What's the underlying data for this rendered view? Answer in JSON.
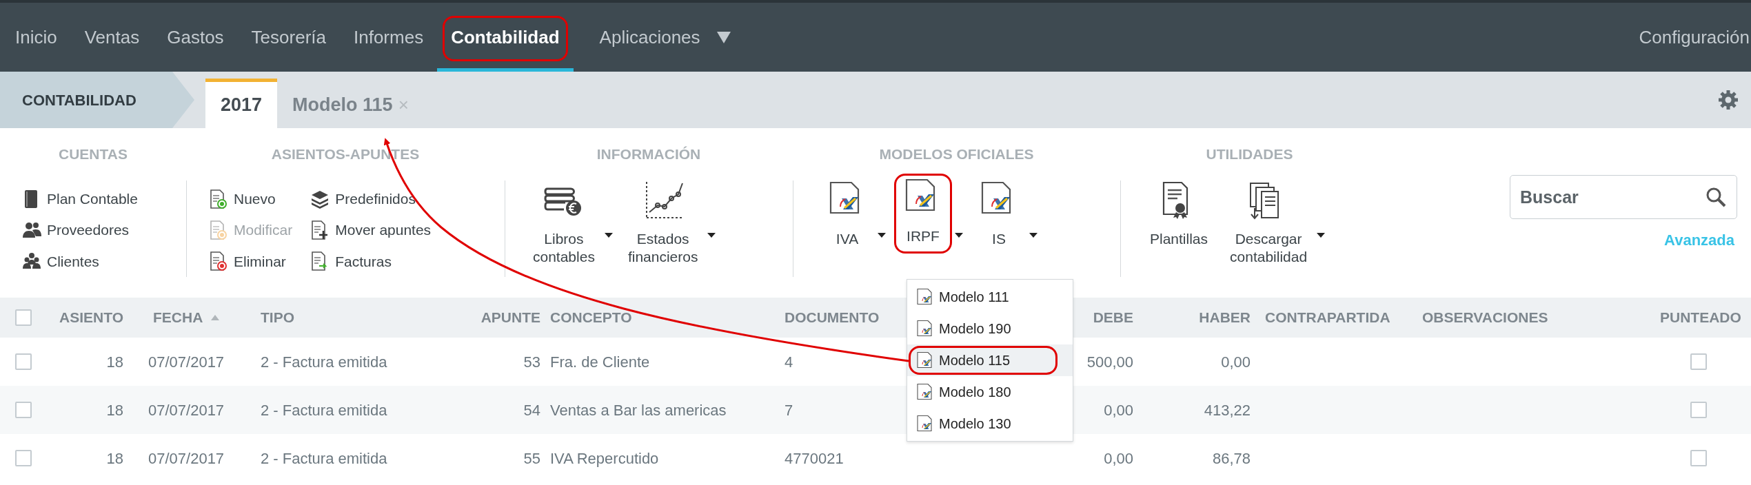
{
  "nav": {
    "items": [
      {
        "label": "Inicio",
        "selected": false,
        "circled": false,
        "dropdown": false
      },
      {
        "label": "Ventas",
        "selected": false,
        "circled": false,
        "dropdown": false
      },
      {
        "label": "Gastos",
        "selected": false,
        "circled": false,
        "dropdown": false
      },
      {
        "label": "Tesorería",
        "selected": false,
        "circled": false,
        "dropdown": false
      },
      {
        "label": "Informes",
        "selected": false,
        "circled": false,
        "dropdown": false
      },
      {
        "label": "Contabilidad",
        "selected": true,
        "circled": true,
        "dropdown": false
      },
      {
        "label": "Aplicaciones",
        "selected": false,
        "circled": false,
        "dropdown": true
      }
    ],
    "config": "Configuración"
  },
  "breadcrumb": "CONTABILIDAD",
  "tabs": [
    {
      "label": "2017",
      "selected": true
    },
    {
      "label": "Modelo 115",
      "selected": false,
      "close": "×"
    }
  ],
  "ribbon": {
    "groups": [
      {
        "title": "CUENTAS",
        "kind": "list",
        "columns": [
          [
            {
              "label": "Plan Contable",
              "disabled": false
            },
            {
              "label": "Proveedores",
              "disabled": false
            },
            {
              "label": "Clientes",
              "disabled": false
            }
          ]
        ]
      },
      {
        "title": "ASIENTOS-APUNTES",
        "kind": "list",
        "columns": [
          [
            {
              "label": "Nuevo",
              "disabled": false
            },
            {
              "label": "Modificar",
              "disabled": true
            },
            {
              "label": "Eliminar",
              "disabled": false
            }
          ],
          [
            {
              "label": "Predefinidos",
              "disabled": false
            },
            {
              "label": "Mover apuntes",
              "disabled": false
            },
            {
              "label": "Facturas",
              "disabled": false
            }
          ]
        ]
      },
      {
        "title": "INFORMACIÓN",
        "kind": "big",
        "buttons": [
          {
            "lines": [
              "Libros",
              "contables"
            ],
            "dropdown": true,
            "circled": false
          },
          {
            "lines": [
              "Estados",
              "financieros"
            ],
            "dropdown": true,
            "circled": false
          }
        ]
      },
      {
        "title": "MODELOS OFICIALES",
        "kind": "big",
        "buttons": [
          {
            "lines": [
              "IVA"
            ],
            "dropdown": true,
            "circled": false
          },
          {
            "lines": [
              "IRPF"
            ],
            "dropdown": true,
            "circled": true
          },
          {
            "lines": [
              "IS"
            ],
            "dropdown": true,
            "circled": false
          }
        ]
      },
      {
        "title": "UTILIDADES",
        "kind": "big",
        "buttons": [
          {
            "lines": [
              "Plantillas"
            ],
            "dropdown": false,
            "circled": false
          },
          {
            "lines": [
              "Descargar",
              "contabilidad"
            ],
            "dropdown": true,
            "circled": false
          }
        ]
      }
    ]
  },
  "search": {
    "placeholder": "Buscar",
    "advanced": "Avanzada"
  },
  "table": {
    "all_checked": false,
    "columns": [
      {
        "label": "ASIENTO",
        "sorted": false
      },
      {
        "label": "FECHA",
        "sorted": true
      },
      {
        "label": "TIPO",
        "sorted": false
      },
      {
        "label": "APUNTE",
        "sorted": false
      },
      {
        "label": "CONCEPTO",
        "sorted": false
      },
      {
        "label": "DOCUMENTO",
        "sorted": false
      },
      {
        "label": "DEBE",
        "sorted": false
      },
      {
        "label": "HABER",
        "sorted": false
      },
      {
        "label": "CONTRAPARTIDA",
        "sorted": false
      },
      {
        "label": "OBSERVACIONES",
        "sorted": false
      },
      {
        "label": "PUNTEADO",
        "sorted": false
      }
    ],
    "rows": [
      {
        "checked": false,
        "cells": [
          "18",
          "07/07/2017",
          "2 - Factura emitida",
          "53",
          "Fra. de Cliente",
          "4",
          "500,00",
          "0,00",
          "",
          ""
        ],
        "punteado": false
      },
      {
        "checked": false,
        "cells": [
          "18",
          "07/07/2017",
          "2 - Factura emitida",
          "54",
          "Ventas a Bar las americas",
          "7",
          "0,00",
          "413,22",
          "",
          ""
        ],
        "punteado": false
      },
      {
        "checked": false,
        "cells": [
          "18",
          "07/07/2017",
          "2 - Factura emitida",
          "55",
          "IVA Repercutido",
          "4770021",
          "0,00",
          "86,78",
          "",
          ""
        ],
        "punteado": false
      }
    ]
  },
  "menu": {
    "items": [
      {
        "label": "Modelo 111",
        "selected": false,
        "circled": false
      },
      {
        "label": "Modelo 190",
        "selected": false,
        "circled": false
      },
      {
        "label": "Modelo 115",
        "selected": true,
        "circled": true
      },
      {
        "label": "Modelo 180",
        "selected": false,
        "circled": false
      },
      {
        "label": "Modelo 130",
        "selected": false,
        "circled": false
      }
    ]
  },
  "annotations": {
    "arrow": true
  }
}
